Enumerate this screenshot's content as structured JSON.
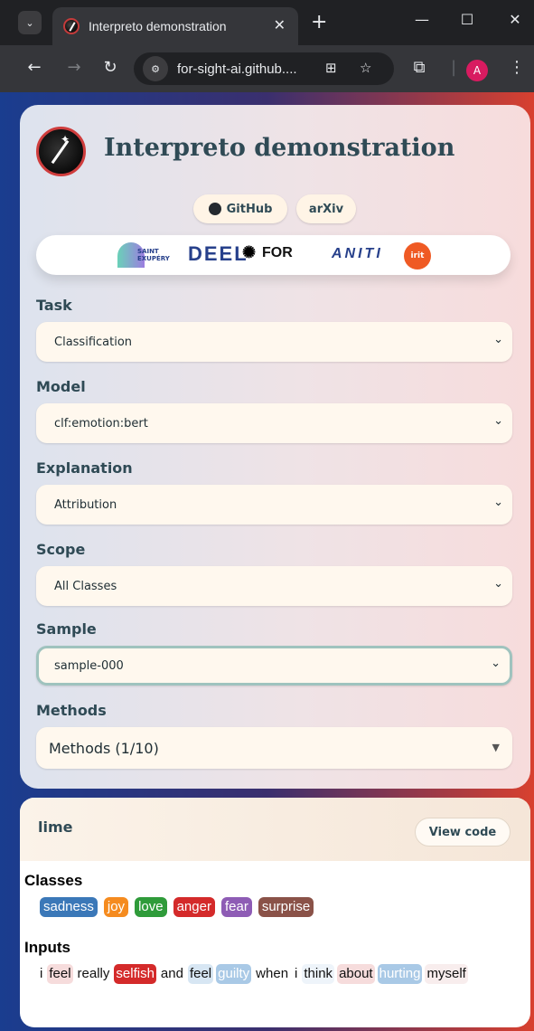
{
  "browser": {
    "tab_title": "Interpreto demonstration",
    "tab_close": "✕",
    "new_tab": "+",
    "minimize": "—",
    "maximize": "☐",
    "close": "✕",
    "url": "for-sight-ai.github....",
    "site_info": "⚙",
    "profile_initial": "A"
  },
  "header": {
    "title": "Interpreto demonstration",
    "github_label": "GitHub",
    "arxiv_label": "arXiv"
  },
  "sponsors": {
    "exupery_top": "SAINT",
    "exupery_bottom": "EXUPÉRY",
    "deel": "DEEL",
    "for": "FOR",
    "aniti": "ANITI",
    "irit": "irit"
  },
  "form": {
    "task_label": "Task",
    "task_value": "Classification",
    "model_label": "Model",
    "model_value": "clf:emotion:bert",
    "explanation_label": "Explanation",
    "explanation_value": "Attribution",
    "scope_label": "Scope",
    "scope_value": "All Classes",
    "sample_label": "Sample",
    "sample_value": "sample-000",
    "methods_label": "Methods",
    "methods_value": "Methods (1/10)"
  },
  "result": {
    "method_name": "lime",
    "view_code_label": "View code",
    "classes_title": "Classes",
    "inputs_title": "Inputs",
    "classes": [
      {
        "label": "sadness",
        "color": "#3b78b8"
      },
      {
        "label": "joy",
        "color": "#f58b1f"
      },
      {
        "label": "love",
        "color": "#2f9b3a"
      },
      {
        "label": "anger",
        "color": "#d42a2a"
      },
      {
        "label": "fear",
        "color": "#8e5cb5"
      },
      {
        "label": "surprise",
        "color": "#8a5248"
      }
    ],
    "tokens": [
      {
        "text": "i",
        "bg": "transparent",
        "fg": "#111111"
      },
      {
        "text": "feel",
        "bg": "#f6dcdc",
        "fg": "#111111"
      },
      {
        "text": "really",
        "bg": "transparent",
        "fg": "#111111"
      },
      {
        "text": "selfish",
        "bg": "#d42a2a",
        "fg": "#ffffff"
      },
      {
        "text": "and",
        "bg": "transparent",
        "fg": "#111111"
      },
      {
        "text": "feel",
        "bg": "#d7e6f3",
        "fg": "#111111"
      },
      {
        "text": "guilty",
        "bg": "#a9c9e6",
        "fg": "#ffffff"
      },
      {
        "text": "when",
        "bg": "transparent",
        "fg": "#111111"
      },
      {
        "text": "i",
        "bg": "transparent",
        "fg": "#111111"
      },
      {
        "text": "think",
        "bg": "#eef4fa",
        "fg": "#111111"
      },
      {
        "text": "about",
        "bg": "#f6dcdc",
        "fg": "#111111"
      },
      {
        "text": "hurting",
        "bg": "#a9c9e6",
        "fg": "#ffffff"
      },
      {
        "text": "myself",
        "bg": "#f8eded",
        "fg": "#111111"
      }
    ]
  }
}
